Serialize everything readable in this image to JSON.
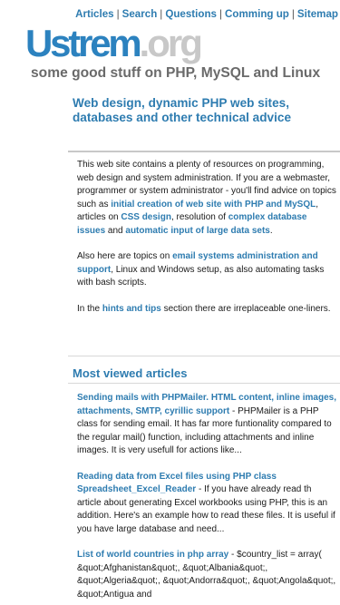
{
  "nav": {
    "items": [
      "Articles",
      "Search",
      "Questions",
      "Comming up",
      "Sitemap"
    ],
    "separator": "|"
  },
  "logo": {
    "main": "Ustrem",
    "ext": ".org"
  },
  "tagline": "some good stuff on PHP, MySQL and Linux",
  "heading": "Web design, dynamic PHP web sites, databases and other technical advice",
  "intro": {
    "p1": {
      "t1": "This web site contains a plenty of resources on programming, web design and system administration. If you are a webmaster, programmer or system administrator - you'll find advice on topics such as ",
      "l1": "initial creation of web site with PHP and MySQL",
      "t2": ", articles on ",
      "l2": "CSS design",
      "t3": ", resolution of ",
      "l3": "complex database issues",
      "t4": " and ",
      "l4": "automatic input of large data sets",
      "t5": "."
    },
    "p2": {
      "t1": "Also here are topics on ",
      "l1": "email systems administration and support",
      "t2": ", Linux and Windows setup, as also automating tasks with bash scripts."
    },
    "p3": {
      "t1": "In the ",
      "l1": "hints and tips",
      "t2": " section there are irreplaceable one-liners."
    }
  },
  "most_viewed": {
    "title": "Most viewed articles",
    "articles": [
      {
        "title": "Sending mails with PHPMailer. HTML content, inline images, attachments, SMTP, cyrillic support",
        "summary": " - PHPMailer is a PHP class for sending email. It has far more funtionality compared to the regular mail() function, including attachments and inline images. It is very usefull for actions like..."
      },
      {
        "title": "Reading data from Excel files using PHP class Spreadsheet_Excel_Reader",
        "summary": " - If you have already read th article about generating Excel workbooks using PHP, this is an addition. Here's an example how to read these files. It is useful if you have large database and need..."
      },
      {
        "title": "List of world countries in php array",
        "summary": " - $country_list = array( &quot;Afghanistan&quot;, &quot;Albania&quot;, &quot;Algeria&quot;, &quot;Andorra&quot;, &quot;Angola&quot;, &quot;Antigua and"
      }
    ]
  },
  "colors": {
    "link": "#2e7cb0",
    "logo_blue": "#2c82bf",
    "logo_grey": "#c8c8c8",
    "tagline": "#6a6a6a"
  }
}
